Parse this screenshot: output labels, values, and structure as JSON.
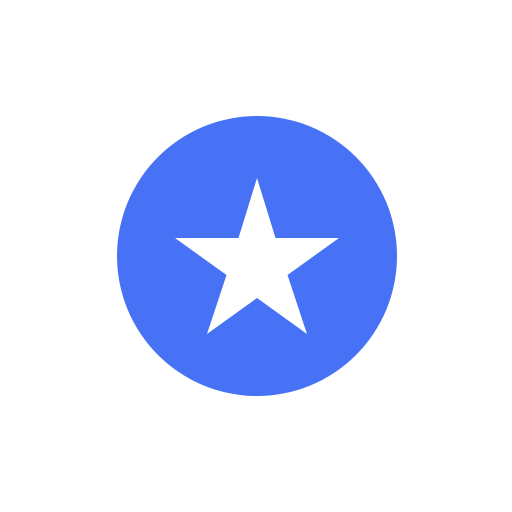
{
  "icon": {
    "name": "star-icon",
    "shape": "five-point-star-in-circle"
  },
  "colors": {
    "background": "#ffffff",
    "circle": "#4772F5",
    "star": "#ffffff"
  }
}
